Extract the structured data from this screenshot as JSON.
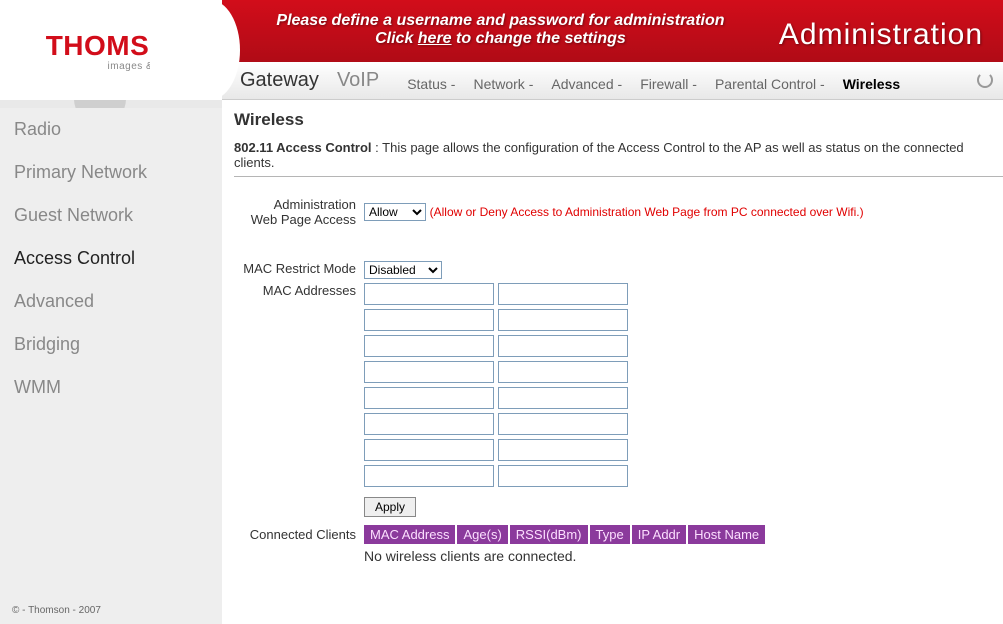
{
  "banner": {
    "line1": "Please define a username and password for administration",
    "line2_before": "Click ",
    "line2_link": "here",
    "line2_after": " to change the settings",
    "right_title": "Administration"
  },
  "logo": {
    "brand": "THOMSON",
    "tagline": "images & beyond"
  },
  "topnav": {
    "main_tabs": [
      {
        "label": "Gateway"
      },
      {
        "label": "VoIP"
      }
    ],
    "sub_tabs": [
      {
        "label": "Status -"
      },
      {
        "label": "Network -"
      },
      {
        "label": "Advanced -"
      },
      {
        "label": "Firewall -"
      },
      {
        "label": "Parental Control -"
      },
      {
        "label": "Wireless",
        "active": true
      }
    ]
  },
  "sidebar": {
    "items": [
      {
        "label": "Radio"
      },
      {
        "label": "Primary Network"
      },
      {
        "label": "Guest Network"
      },
      {
        "label": "Access Control",
        "active": true
      },
      {
        "label": "Advanced"
      },
      {
        "label": "Bridging"
      },
      {
        "label": "WMM"
      }
    ],
    "copyright": "© - Thomson - 2007"
  },
  "page": {
    "title": "Wireless",
    "section_title": "802.11 Access Control",
    "section_sep": " :  ",
    "section_desc": "This page allows the configuration of the Access Control to the AP as well as status on the connected clients.",
    "admin_access_label_l1": "Administration",
    "admin_access_label_l2": "Web Page Access",
    "admin_access_value": "Allow",
    "admin_access_hint": "(Allow or Deny Access to Administration Web Page from PC connected over Wifi.)",
    "mac_restrict_label": "MAC Restrict Mode",
    "mac_restrict_value": "Disabled",
    "mac_addresses_label": "MAC Addresses",
    "mac_rows": 8,
    "apply_label": "Apply",
    "connected_clients_label": "Connected Clients",
    "clients_headers": [
      "MAC Address",
      "Age(s)",
      "RSSI(dBm)",
      "Type",
      "IP Addr",
      "Host Name"
    ],
    "no_clients_msg": "No wireless clients are connected."
  }
}
